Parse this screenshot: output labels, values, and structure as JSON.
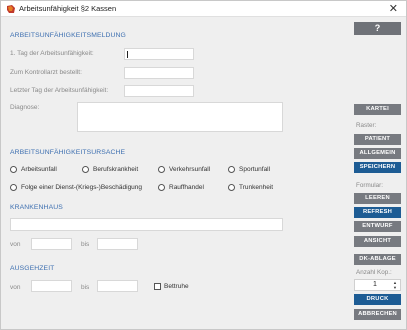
{
  "window": {
    "title": "Arbeitsunfähigkeit §2 Kassen",
    "close_icon": "close-icon",
    "app_icon": "app-icon"
  },
  "meldung": {
    "section_title": "ARBEITSUNFÄHIGKEITSMELDUNG",
    "erster_tag_label": "1. Tag der Arbeitsunfähigkeit:",
    "kontrollarzt_label": "Zum Kontrollarzt bestellt:",
    "letzter_tag_label": "Letzter Tag der Arbeitsunfähigkeit:",
    "diagnose_label": "Diagnose:"
  },
  "ursache": {
    "section_title": "ARBEITSUNFÄHIGKEITSURSACHE",
    "options": [
      "Arbeitsunfall",
      "Berufskrankheit",
      "Verkehrsunfall",
      "Sportunfall",
      "Folge einer Dienst-(Kriegs-)Beschädigung",
      "Rauffhandel",
      "Trunkenheit"
    ]
  },
  "krankenhaus": {
    "section_title": "KRANKENHAUS",
    "von_label": "von",
    "bis_label": "bis"
  },
  "ausgehzeit": {
    "section_title": "AUSGEHZEIT",
    "von_label": "von",
    "bis_label": "bis",
    "bettruhe_label": "Bettruhe"
  },
  "sidebar": {
    "help_label": "?",
    "kartei_label": "KARTEI",
    "raster_label": "Raster:",
    "patient_label": "PATIENT",
    "allgemein_label": "ALLGEMEIN",
    "speichern_label": "SPEICHERN",
    "formular_label": "Formular:",
    "leeren_label": "LEEREN",
    "refresh_label": "REFRESH",
    "entwurf_label": "ENTWURF",
    "ansicht_label": "ANSICHT",
    "dk_ablage_label": "DK-ABLAGE",
    "anzahl_label": "Anzahl Kop.:",
    "anzahl_value": "1",
    "druck_label": "DRUCK",
    "abbrechen_label": "ABBRECHEN"
  }
}
